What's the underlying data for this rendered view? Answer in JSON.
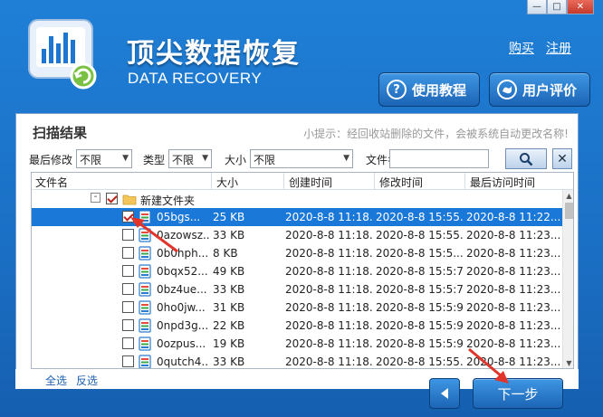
{
  "header": {
    "title_cn": "顶尖数据恢复",
    "title_en": "DATA RECOVERY",
    "link_buy": "购买",
    "link_register": "注册",
    "btn_tutorial": "使用教程",
    "btn_review": "用户评价",
    "tutorial_icon_glyph": "?",
    "window_min": "—",
    "window_max": "□",
    "window_close": "✕"
  },
  "panel": {
    "title": "扫描结果",
    "tip": "小提示：经回收站删除的文件，会被系统自动更改名称!"
  },
  "filters": {
    "last_modified_label": "最后修改",
    "last_modified_value": "不限",
    "type_label": "类型",
    "type_value": "不限",
    "size_label": "大小",
    "size_value": "不限",
    "filename_label": "文件名",
    "filename_value": ""
  },
  "table": {
    "columns": [
      "文件名",
      "大小",
      "创建时间",
      "修改时间",
      "最后访问时间"
    ],
    "folder": {
      "name": "新建文件夹",
      "checked": true,
      "expander": "-"
    },
    "rows": [
      {
        "name": "05bgs...",
        "size": "25 KB",
        "created": "2020-8-8 11:18...",
        "modified": "2020-8-8 15:55...",
        "accessed": "2020-8-8 11:22...",
        "checked": true,
        "selected": true
      },
      {
        "name": "0azowsz...",
        "size": "33 KB",
        "created": "2020-8-8 11:18...",
        "modified": "2020-8-8 15:55...",
        "accessed": "2020-8-8 11:23...",
        "checked": false,
        "selected": false
      },
      {
        "name": "0b0hph...",
        "size": "8 KB",
        "created": "2020-8-8 11:18...",
        "modified": "2020-8-8 15:5...",
        "accessed": "2020-8-8 11:23...",
        "checked": false,
        "selected": false
      },
      {
        "name": "0bqx52...",
        "size": "49 KB",
        "created": "2020-8-8 11:18...",
        "modified": "2020-8-8 15:5:7",
        "accessed": "2020-8-8 11:23...",
        "checked": false,
        "selected": false
      },
      {
        "name": "0bz4ue...",
        "size": "33 KB",
        "created": "2020-8-8 11:18...",
        "modified": "2020-8-8 15:5:7",
        "accessed": "2020-8-8 11:23...",
        "checked": false,
        "selected": false
      },
      {
        "name": "0ho0jw...",
        "size": "31 KB",
        "created": "2020-8-8 11:18...",
        "modified": "2020-8-8 15:5:9",
        "accessed": "2020-8-8 11:23...",
        "checked": false,
        "selected": false
      },
      {
        "name": "0npd3g...",
        "size": "22 KB",
        "created": "2020-8-8 11:18...",
        "modified": "2020-8-8 15:5:9",
        "accessed": "2020-8-8 11:23...",
        "checked": false,
        "selected": false
      },
      {
        "name": "0ozpus...",
        "size": "19 KB",
        "created": "2020-8-8 11:18...",
        "modified": "2020-8-8 15:5:9",
        "accessed": "2020-8-8 11:23...",
        "checked": false,
        "selected": false
      },
      {
        "name": "0qutch4...",
        "size": "33 KB",
        "created": "2020-8-8 11:18...",
        "modified": "2020-8-8 15:55...",
        "accessed": "2020-8-8 11:23...",
        "checked": false,
        "selected": false
      }
    ]
  },
  "footer": {
    "select_all": "全选",
    "invert": "反选",
    "next": "下一步"
  },
  "colors": {
    "brand_blue": "#1a6fc4",
    "selected_row": "#1a78d8",
    "annotation_red": "#e0352b",
    "check_red": "#c0201a"
  },
  "icons": {
    "back_button": "arrow-left-icon",
    "search_button": "magnifier-icon",
    "clear_button": "close-icon",
    "file": "document-icon",
    "folder": "folder-icon"
  }
}
